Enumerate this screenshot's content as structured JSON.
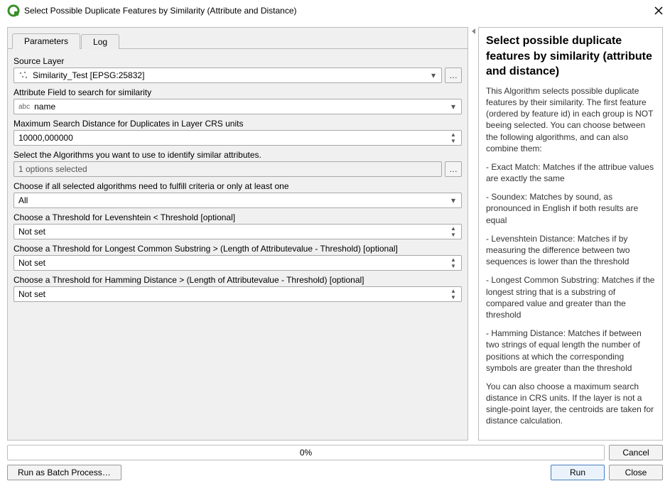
{
  "window": {
    "title": "Select Possible Duplicate Features by Similarity (Attribute and Distance)"
  },
  "tabs": {
    "parameters": "Parameters",
    "log": "Log"
  },
  "form": {
    "source_layer_label": "Source Layer",
    "source_layer_value": "Similarity_Test [EPSG:25832]",
    "attr_field_label": "Attribute Field to search for similarity",
    "attr_field_prefix": "abc",
    "attr_field_value": "name",
    "max_dist_label": "Maximum Search Distance for Duplicates in Layer CRS units",
    "max_dist_value": "10000,000000",
    "algo_label": "Select the Algorithms you want to use to identify similar attributes.",
    "algo_value": "1 options selected",
    "fulfil_label": "Choose if all selected algorithms need to fulfill criteria or only at least one",
    "fulfil_value": "All",
    "lev_label": "Choose a Threshold for Levenshtein < Threshold [optional]",
    "lev_value": "Not set",
    "lcs_label": "Choose a Threshold for Longest Common Substring > (Length of Attributevalue - Threshold) [optional]",
    "lcs_value": "Not set",
    "ham_label": "Choose a Threshold for Hamming Distance > (Length of Attributevalue - Threshold) [optional]",
    "ham_value": "Not set"
  },
  "help": {
    "title": "Select possible duplicate features by similarity (attribute and distance)",
    "p1": "This Algorithm selects possible duplicate features by their similarity. The first feature (ordered by feature id) in each group is NOT beeing selected. You can choose between the following algorithms, and can also combine them:",
    "p2": "- Exact Match: Matches if the attribue values are exactly the same",
    "p3": "- Soundex: Matches by sound, as pronounced in English if both results are equal",
    "p4": "- Levenshtein Distance: Matches if by measuring the difference between two sequences is lower than the threshold",
    "p5": "- Longest Common Substring: Matches if the longest string that is a substring of compared value and greater than the threshold",
    "p6": "- Hamming Distance: Matches if between two strings of equal length the number of positions at which the corresponding symbols are greater than the threshold",
    "p7": "You can also choose a maximum search distance in CRS units. If the layer is not a single-point layer, the centroids are taken for distance calculation."
  },
  "progress": {
    "text": "0%"
  },
  "buttons": {
    "cancel": "Cancel",
    "batch": "Run as Batch Process…",
    "run": "Run",
    "close": "Close"
  }
}
